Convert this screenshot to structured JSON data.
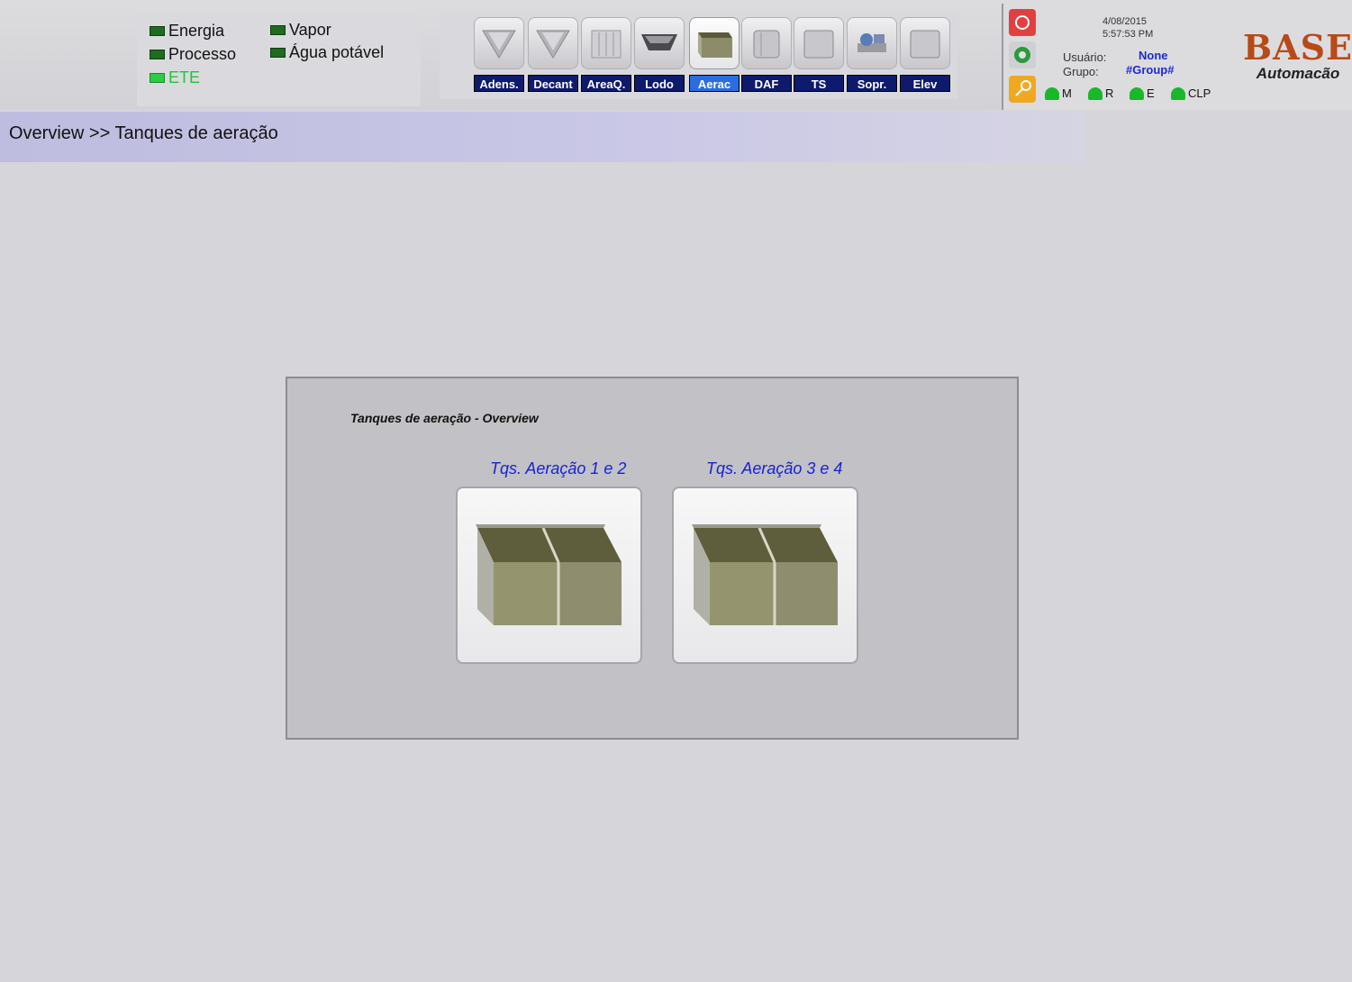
{
  "legend": {
    "items": [
      {
        "label": "Energia"
      },
      {
        "label": "Processo"
      },
      {
        "label": "ETE"
      },
      {
        "label": "Vapor"
      },
      {
        "label": "Água potável"
      }
    ]
  },
  "nav": {
    "buttons": [
      {
        "label": "Adens.",
        "icon": "cone-tank-icon"
      },
      {
        "label": "Decant",
        "icon": "cone-tank-icon"
      },
      {
        "label": "AreaQ.",
        "icon": "grid-tank-icon"
      },
      {
        "label": "Lodo",
        "icon": "basin-icon"
      },
      {
        "label": "Aerac",
        "icon": "aeration-tank-icon",
        "selected": true
      },
      {
        "label": "DAF",
        "icon": "cylinder-tank-icon"
      },
      {
        "label": "TS",
        "icon": "cylinder-tank-icon"
      },
      {
        "label": "Sopr.",
        "icon": "blower-icon"
      },
      {
        "label": "Elev",
        "icon": "cylinder-tank-icon"
      }
    ]
  },
  "status": {
    "date": "4/08/2015",
    "time": "5:57:53 PM",
    "user_label": "Usuário:",
    "user_value": "None",
    "group_label": "Grupo:",
    "group_value": "#Group#",
    "lamps": [
      {
        "label": "M"
      },
      {
        "label": "R"
      },
      {
        "label": "E"
      },
      {
        "label": "CLP"
      }
    ]
  },
  "brand": {
    "name": "BASE",
    "tagline": "Automacão"
  },
  "breadcrumb": "Overview >> Tanques de aeração",
  "panel": {
    "title": "Tanques de aeração - Overview",
    "tanks": [
      {
        "label": "Tqs. Aeração 1 e 2"
      },
      {
        "label": "Tqs. Aeração 3 e 4"
      }
    ]
  },
  "colors": {
    "nav_bg": "#0e1a6b",
    "nav_selected": "#2b6de0",
    "lamp_on": "#18b82a",
    "link": "#1622d8",
    "tank": "#8c8c6a"
  }
}
